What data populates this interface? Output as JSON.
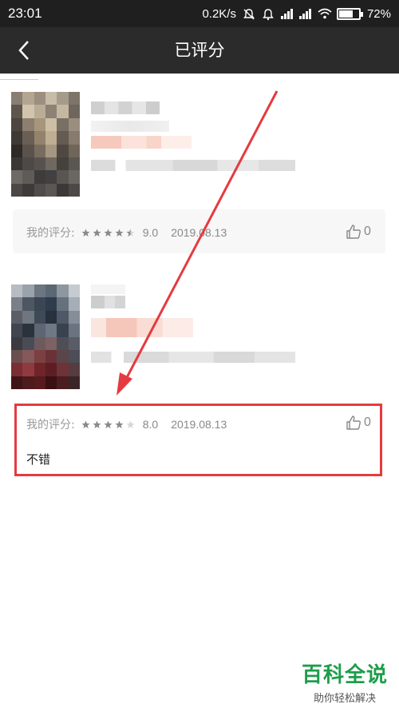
{
  "status_bar": {
    "time": "23:01",
    "speed": "0.2K/s",
    "battery": "72%",
    "battery_level": 0.72
  },
  "header": {
    "title": "已评分"
  },
  "reviews": [
    {
      "my_label": "我的评分:",
      "stars": 4.5,
      "score": "9.0",
      "date": "2019.08.13",
      "likes": "0"
    },
    {
      "my_label": "我的评分:",
      "stars": 4,
      "score": "8.0",
      "date": "2019.08.13",
      "likes": "0",
      "comment": "不错"
    }
  ],
  "annotation": {
    "arrow_color": "#e53a3f",
    "box_color": "#e53a3f"
  },
  "watermark": {
    "title": "百科全说",
    "subtitle": "助你轻松解决"
  }
}
